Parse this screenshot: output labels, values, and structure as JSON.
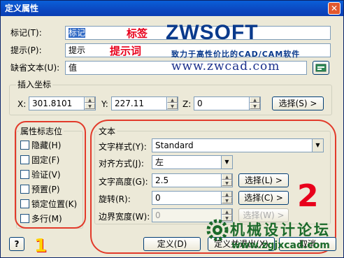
{
  "window": {
    "title": "定义属性",
    "close": "✕"
  },
  "fields": {
    "tag_label": "标记(T):",
    "tag_value": "标记",
    "prompt_label": "提示(P):",
    "prompt_value": "提示",
    "default_label": "缺省文本(U):",
    "default_value": "值"
  },
  "annotations": {
    "tag": "标签",
    "prompt": "提示词",
    "one": "1",
    "two": "2"
  },
  "logo": {
    "brand": "ZWSOFT",
    "slogan": "致力于高性价比的CAD/CAM软件",
    "url": "www.zwcad.com"
  },
  "insert": {
    "group_title": "插入坐标",
    "x_label": "X:",
    "x_value": "301.8101",
    "y_label": "Y:",
    "y_value": "227.11",
    "z_label": "Z:",
    "z_value": "0",
    "select_button": "选择(S) >"
  },
  "flags": {
    "group_title": "属性标志位",
    "items": [
      {
        "label": "隐藏(H)"
      },
      {
        "label": "固定(F)"
      },
      {
        "label": "验证(V)"
      },
      {
        "label": "预置(P)"
      },
      {
        "label": "锁定位置(K)"
      },
      {
        "label": "多行(M)"
      }
    ]
  },
  "text": {
    "group_title": "文本",
    "style_label": "文字样式(Y):",
    "style_value": "Standard",
    "align_label": "对齐方式(J):",
    "align_value": "左",
    "height_label": "文字高度(G):",
    "height_value": "2.5",
    "height_button": "选择(L) >",
    "rotate_label": "旋转(R):",
    "rotate_value": "0",
    "rotate_button": "选择(C) >",
    "width_label": "边界宽度(W):",
    "width_value": "0",
    "width_button": "选择(W) >"
  },
  "buttons": {
    "help": "?",
    "define": "定义(D)",
    "define_exit": "定义并退出(X)",
    "cancel": "取消"
  },
  "watermark": {
    "site_name": "机械设计论坛",
    "site_url": "www.zgjxcad.com"
  }
}
